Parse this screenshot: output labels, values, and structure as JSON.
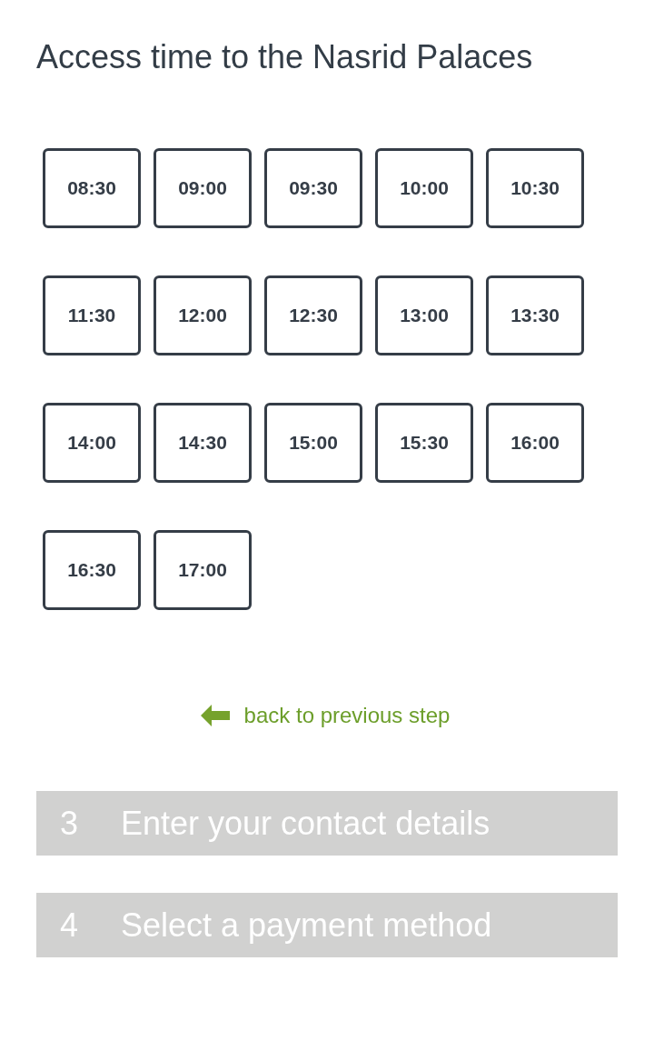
{
  "title": "Access time to the Nasrid Palaces",
  "time_slots": [
    "08:30",
    "09:00",
    "09:30",
    "10:00",
    "10:30",
    "11:30",
    "12:00",
    "12:30",
    "13:00",
    "13:30",
    "14:00",
    "14:30",
    "15:00",
    "15:30",
    "16:00",
    "16:30",
    "17:00"
  ],
  "back_link": "back to previous step",
  "steps": [
    {
      "number": "3",
      "label": "Enter your contact details",
      "disabled": true
    },
    {
      "number": "4",
      "label": "Select a payment method",
      "disabled": true
    }
  ]
}
